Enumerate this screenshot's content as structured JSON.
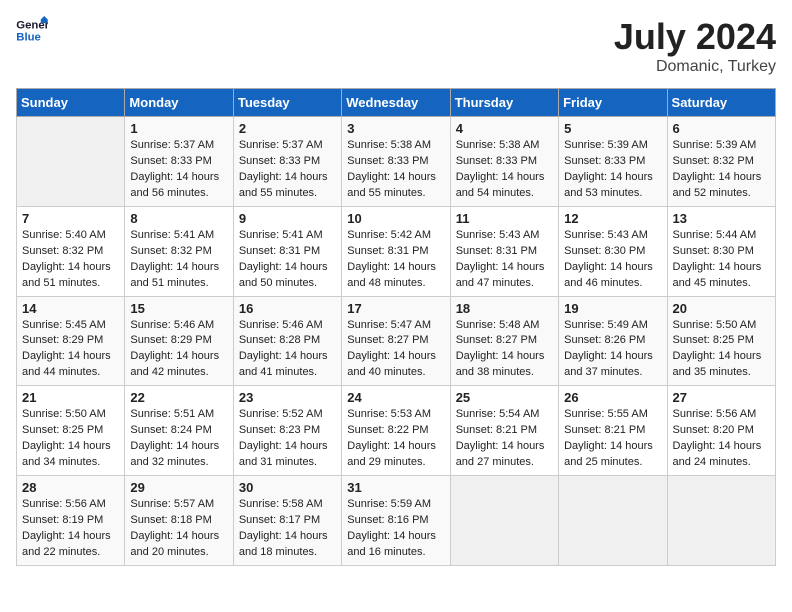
{
  "header": {
    "logo_general": "General",
    "logo_blue": "Blue",
    "month_year": "July 2024",
    "location": "Domanic, Turkey"
  },
  "weekdays": [
    "Sunday",
    "Monday",
    "Tuesday",
    "Wednesday",
    "Thursday",
    "Friday",
    "Saturday"
  ],
  "weeks": [
    [
      {
        "day": "",
        "empty": true
      },
      {
        "day": "1",
        "sunrise": "5:37 AM",
        "sunset": "8:33 PM",
        "daylight": "14 hours and 56 minutes."
      },
      {
        "day": "2",
        "sunrise": "5:37 AM",
        "sunset": "8:33 PM",
        "daylight": "14 hours and 55 minutes."
      },
      {
        "day": "3",
        "sunrise": "5:38 AM",
        "sunset": "8:33 PM",
        "daylight": "14 hours and 55 minutes."
      },
      {
        "day": "4",
        "sunrise": "5:38 AM",
        "sunset": "8:33 PM",
        "daylight": "14 hours and 54 minutes."
      },
      {
        "day": "5",
        "sunrise": "5:39 AM",
        "sunset": "8:33 PM",
        "daylight": "14 hours and 53 minutes."
      },
      {
        "day": "6",
        "sunrise": "5:39 AM",
        "sunset": "8:32 PM",
        "daylight": "14 hours and 52 minutes."
      }
    ],
    [
      {
        "day": "7",
        "sunrise": "5:40 AM",
        "sunset": "8:32 PM",
        "daylight": "14 hours and 51 minutes."
      },
      {
        "day": "8",
        "sunrise": "5:41 AM",
        "sunset": "8:32 PM",
        "daylight": "14 hours and 51 minutes."
      },
      {
        "day": "9",
        "sunrise": "5:41 AM",
        "sunset": "8:31 PM",
        "daylight": "14 hours and 50 minutes."
      },
      {
        "day": "10",
        "sunrise": "5:42 AM",
        "sunset": "8:31 PM",
        "daylight": "14 hours and 48 minutes."
      },
      {
        "day": "11",
        "sunrise": "5:43 AM",
        "sunset": "8:31 PM",
        "daylight": "14 hours and 47 minutes."
      },
      {
        "day": "12",
        "sunrise": "5:43 AM",
        "sunset": "8:30 PM",
        "daylight": "14 hours and 46 minutes."
      },
      {
        "day": "13",
        "sunrise": "5:44 AM",
        "sunset": "8:30 PM",
        "daylight": "14 hours and 45 minutes."
      }
    ],
    [
      {
        "day": "14",
        "sunrise": "5:45 AM",
        "sunset": "8:29 PM",
        "daylight": "14 hours and 44 minutes."
      },
      {
        "day": "15",
        "sunrise": "5:46 AM",
        "sunset": "8:29 PM",
        "daylight": "14 hours and 42 minutes."
      },
      {
        "day": "16",
        "sunrise": "5:46 AM",
        "sunset": "8:28 PM",
        "daylight": "14 hours and 41 minutes."
      },
      {
        "day": "17",
        "sunrise": "5:47 AM",
        "sunset": "8:27 PM",
        "daylight": "14 hours and 40 minutes."
      },
      {
        "day": "18",
        "sunrise": "5:48 AM",
        "sunset": "8:27 PM",
        "daylight": "14 hours and 38 minutes."
      },
      {
        "day": "19",
        "sunrise": "5:49 AM",
        "sunset": "8:26 PM",
        "daylight": "14 hours and 37 minutes."
      },
      {
        "day": "20",
        "sunrise": "5:50 AM",
        "sunset": "8:25 PM",
        "daylight": "14 hours and 35 minutes."
      }
    ],
    [
      {
        "day": "21",
        "sunrise": "5:50 AM",
        "sunset": "8:25 PM",
        "daylight": "14 hours and 34 minutes."
      },
      {
        "day": "22",
        "sunrise": "5:51 AM",
        "sunset": "8:24 PM",
        "daylight": "14 hours and 32 minutes."
      },
      {
        "day": "23",
        "sunrise": "5:52 AM",
        "sunset": "8:23 PM",
        "daylight": "14 hours and 31 minutes."
      },
      {
        "day": "24",
        "sunrise": "5:53 AM",
        "sunset": "8:22 PM",
        "daylight": "14 hours and 29 minutes."
      },
      {
        "day": "25",
        "sunrise": "5:54 AM",
        "sunset": "8:21 PM",
        "daylight": "14 hours and 27 minutes."
      },
      {
        "day": "26",
        "sunrise": "5:55 AM",
        "sunset": "8:21 PM",
        "daylight": "14 hours and 25 minutes."
      },
      {
        "day": "27",
        "sunrise": "5:56 AM",
        "sunset": "8:20 PM",
        "daylight": "14 hours and 24 minutes."
      }
    ],
    [
      {
        "day": "28",
        "sunrise": "5:56 AM",
        "sunset": "8:19 PM",
        "daylight": "14 hours and 22 minutes."
      },
      {
        "day": "29",
        "sunrise": "5:57 AM",
        "sunset": "8:18 PM",
        "daylight": "14 hours and 20 minutes."
      },
      {
        "day": "30",
        "sunrise": "5:58 AM",
        "sunset": "8:17 PM",
        "daylight": "14 hours and 18 minutes."
      },
      {
        "day": "31",
        "sunrise": "5:59 AM",
        "sunset": "8:16 PM",
        "daylight": "14 hours and 16 minutes."
      },
      {
        "day": "",
        "empty": true
      },
      {
        "day": "",
        "empty": true
      },
      {
        "day": "",
        "empty": true
      }
    ]
  ]
}
